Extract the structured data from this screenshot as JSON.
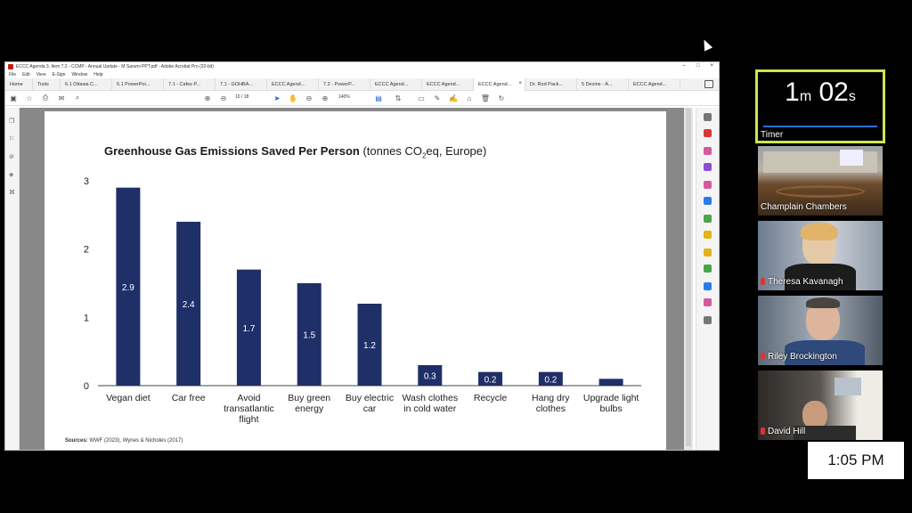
{
  "window": {
    "title": "ECCC Agenda 3, Item 7.2 - CCMP - Annual Update - M Sarumi PPT.pdf - Adobe Acrobat Pro (32-bit)",
    "controls": [
      "–",
      "□",
      "×"
    ]
  },
  "menu": [
    "File",
    "Edit",
    "View",
    "E-Sign",
    "Window",
    "Help"
  ],
  "tabs": [
    {
      "label": "Home"
    },
    {
      "label": "Tools"
    },
    {
      "label": "6.1 Ottawa C..."
    },
    {
      "label": "6.1 PowerPoi..."
    },
    {
      "label": "7.1 - Cafes P..."
    },
    {
      "label": "7.1 - GOHBA..."
    },
    {
      "label": "ECCC Agend..."
    },
    {
      "label": "7.2 - PowerP..."
    },
    {
      "label": "ECCC Agend..."
    },
    {
      "label": "ECCC Agend..."
    },
    {
      "label": "ECCC Agend..."
    },
    {
      "label": "Dr. Rod Pack..."
    },
    {
      "label": "5 Devine - A..."
    },
    {
      "label": "ECCC Agend..."
    }
  ],
  "toolbar": {
    "page_current": "10",
    "page_total": "/ 18",
    "zoom": "140%"
  },
  "slide": {
    "title_bold": "Greenhouse Gas Emissions Saved Per Person",
    "title_pre": " (tonnes CO",
    "title_sub": "2",
    "title_post": "eq, Europe)",
    "sources_bold": "Sources:",
    "sources_text": " WWF (2023), Wynes & Nicholes (2017)"
  },
  "chart_data": {
    "type": "bar",
    "categories": [
      "Vegan diet",
      "Car free",
      "Avoid transatlantic flight",
      "Buy green energy",
      "Buy electric car",
      "Wash clothes in cold water",
      "Recycle",
      "Hang dry clothes",
      "Upgrade light bulbs"
    ],
    "category_lines": [
      [
        "Vegan diet"
      ],
      [
        "Car free"
      ],
      [
        "Avoid",
        "transatlantic",
        "flight"
      ],
      [
        "Buy green",
        "energy"
      ],
      [
        "Buy electric",
        "car"
      ],
      [
        "Wash clothes",
        "in cold water"
      ],
      [
        "Recycle"
      ],
      [
        "Hang dry",
        "clothes"
      ],
      [
        "Upgrade light",
        "bulbs"
      ]
    ],
    "values": [
      2.9,
      2.4,
      1.7,
      1.5,
      1.2,
      0.3,
      0.2,
      0.2,
      0.1
    ],
    "value_labels": [
      "2.9",
      "2.4",
      "1.7",
      "1.5",
      "1.2",
      "0.3",
      "0.2",
      "0.2",
      ""
    ],
    "yticks": [
      "0",
      "1",
      "2",
      "3"
    ],
    "ylim": [
      0,
      3
    ],
    "bar_color": "#1f2f68",
    "grid": false,
    "title": "Greenhouse Gas Emissions Saved Per Person (tonnes CO2eq, Europe)"
  },
  "meeting": {
    "timer_minutes": "1",
    "timer_m": "m",
    "timer_seconds": "02",
    "timer_s": "s",
    "timer_label": "Timer",
    "accent": "#cfe54a",
    "participants": [
      {
        "name": "Champlain Chambers"
      },
      {
        "name": "Theresa Kavanagh"
      },
      {
        "name": "Riley Brockington"
      },
      {
        "name": "David Hill"
      }
    ],
    "clock": "1:05 PM"
  }
}
